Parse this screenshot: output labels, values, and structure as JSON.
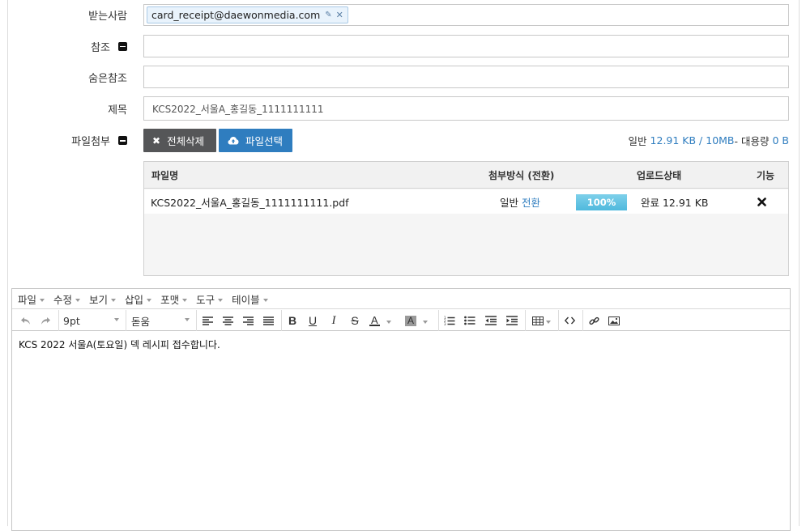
{
  "fields": {
    "to_label": "받는사람",
    "to_tag": "card_receipt@daewonmedia.com",
    "cc_label": "참조",
    "bcc_label": "숨은참조",
    "subject_label": "제목",
    "subject_value": "KCS2022_서울A_홍길동_1111111111",
    "attach_label": "파일첨부"
  },
  "attach": {
    "delete_all": "전체삭제",
    "select_file": "파일선택",
    "quota_prefix": "일반",
    "quota_used": "12.91 KB / 10MB",
    "quota_sep": " - 대용량",
    "quota_large": "0 B"
  },
  "file_table": {
    "columns": [
      "파일명",
      "첨부방식 (전환)",
      "업로드상태",
      "기능"
    ],
    "rows": [
      {
        "name": "KCS2022_서울A_홍길동_1111111111.pdf",
        "method": "일반",
        "switch_link": "전환",
        "progress": 1.0,
        "progress_label": "100%",
        "status": "완료 12.91 KB",
        "action_icon": "close-icon"
      }
    ]
  },
  "editor": {
    "menus": [
      "파일",
      "수정",
      "보기",
      "삽입",
      "포맷",
      "도구",
      "테이블"
    ],
    "font_size": "9pt",
    "font_family": "돋움",
    "body_text": "KCS 2022 서울A(토요일) 덱 레시피 접수합니다."
  },
  "colors": {
    "accent_blue": "#2f7dbf",
    "dark_button": "#555658",
    "progress": "#5bc0de"
  }
}
